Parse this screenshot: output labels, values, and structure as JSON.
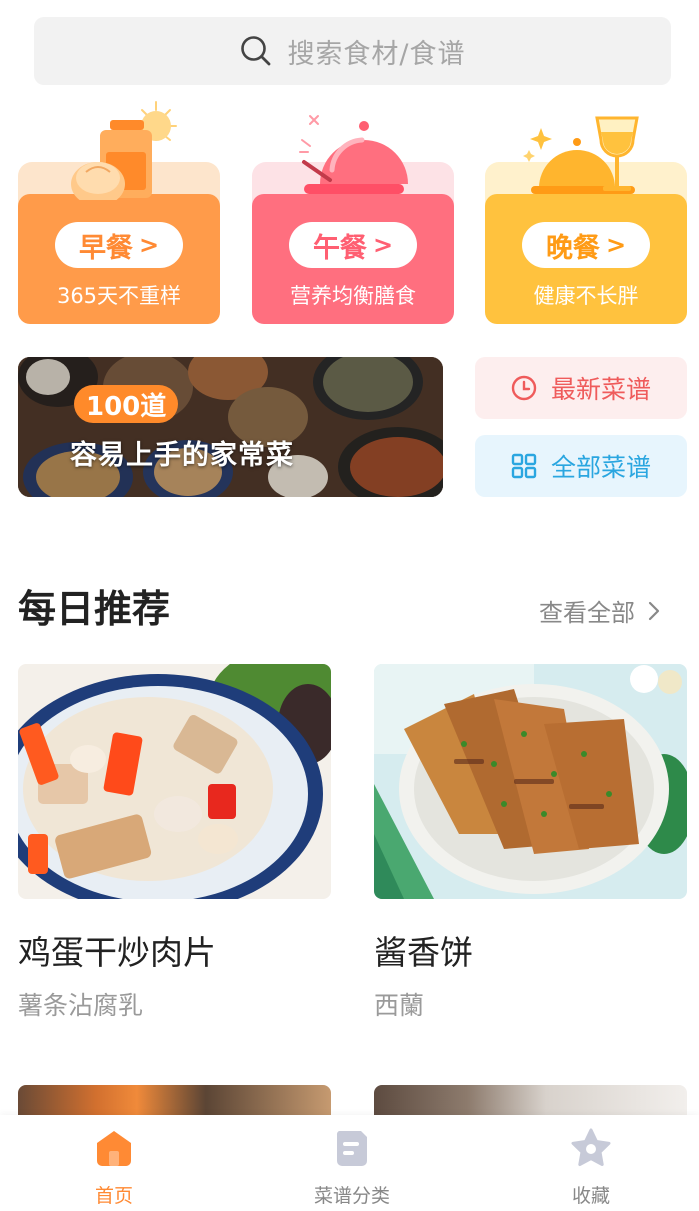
{
  "search": {
    "placeholder": "搜索食材/食谱",
    "icon": "search-icon"
  },
  "meals": [
    {
      "label": "早餐",
      "chevron": ">",
      "subtitle": "365天不重样",
      "color": "#ff9b4a"
    },
    {
      "label": "午餐",
      "chevron": ">",
      "subtitle": "营养均衡膳食",
      "color": "#ff6f7f"
    },
    {
      "label": "晚餐",
      "chevron": ">",
      "subtitle": "健康不长胖",
      "color": "#ffc23e"
    }
  ],
  "banner": {
    "count": "100道",
    "title": "容易上手的家常菜"
  },
  "side_buttons": {
    "latest": {
      "label": "最新菜谱",
      "icon": "clock-icon",
      "color": "#ef5b5b"
    },
    "all": {
      "label": "全部菜谱",
      "icon": "grid-icon",
      "color": "#2aa6e0"
    }
  },
  "daily": {
    "title": "每日推荐",
    "view_all": "查看全部",
    "recipes": [
      {
        "name": "鸡蛋干炒肉片",
        "author": "薯条沾腐乳"
      },
      {
        "name": "酱香饼",
        "author": "西蘭"
      }
    ]
  },
  "tabbar": {
    "accent": "#ff8a34",
    "tabs": [
      {
        "label": "首页",
        "icon": "home-icon",
        "active": true
      },
      {
        "label": "菜谱分类",
        "icon": "recipe-book-icon",
        "active": false
      },
      {
        "label": "收藏",
        "icon": "star-icon",
        "active": false
      }
    ]
  }
}
